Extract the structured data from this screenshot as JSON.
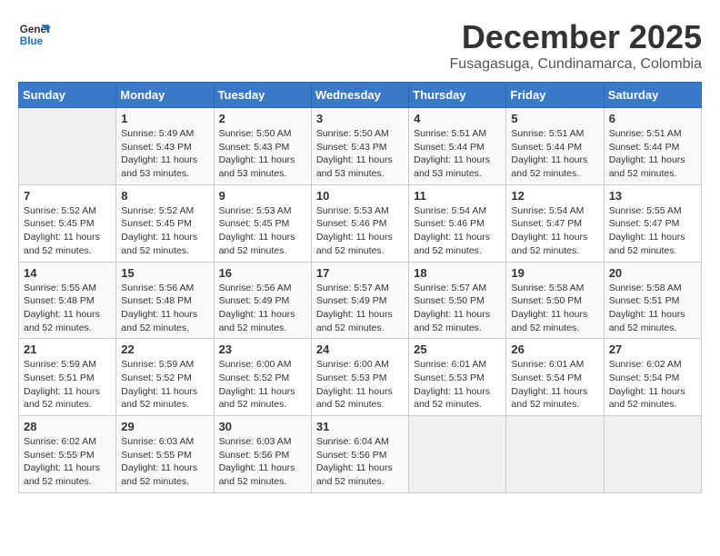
{
  "logo": {
    "line1": "General",
    "line2": "Blue"
  },
  "title": "December 2025",
  "location": "Fusagasuga, Cundinamarca, Colombia",
  "days_of_week": [
    "Sunday",
    "Monday",
    "Tuesday",
    "Wednesday",
    "Thursday",
    "Friday",
    "Saturday"
  ],
  "weeks": [
    [
      {
        "day": "",
        "info": ""
      },
      {
        "day": "1",
        "info": "Sunrise: 5:49 AM\nSunset: 5:43 PM\nDaylight: 11 hours\nand 53 minutes."
      },
      {
        "day": "2",
        "info": "Sunrise: 5:50 AM\nSunset: 5:43 PM\nDaylight: 11 hours\nand 53 minutes."
      },
      {
        "day": "3",
        "info": "Sunrise: 5:50 AM\nSunset: 5:43 PM\nDaylight: 11 hours\nand 53 minutes."
      },
      {
        "day": "4",
        "info": "Sunrise: 5:51 AM\nSunset: 5:44 PM\nDaylight: 11 hours\nand 53 minutes."
      },
      {
        "day": "5",
        "info": "Sunrise: 5:51 AM\nSunset: 5:44 PM\nDaylight: 11 hours\nand 52 minutes."
      },
      {
        "day": "6",
        "info": "Sunrise: 5:51 AM\nSunset: 5:44 PM\nDaylight: 11 hours\nand 52 minutes."
      }
    ],
    [
      {
        "day": "7",
        "info": "Sunrise: 5:52 AM\nSunset: 5:45 PM\nDaylight: 11 hours\nand 52 minutes."
      },
      {
        "day": "8",
        "info": "Sunrise: 5:52 AM\nSunset: 5:45 PM\nDaylight: 11 hours\nand 52 minutes."
      },
      {
        "day": "9",
        "info": "Sunrise: 5:53 AM\nSunset: 5:45 PM\nDaylight: 11 hours\nand 52 minutes."
      },
      {
        "day": "10",
        "info": "Sunrise: 5:53 AM\nSunset: 5:46 PM\nDaylight: 11 hours\nand 52 minutes."
      },
      {
        "day": "11",
        "info": "Sunrise: 5:54 AM\nSunset: 5:46 PM\nDaylight: 11 hours\nand 52 minutes."
      },
      {
        "day": "12",
        "info": "Sunrise: 5:54 AM\nSunset: 5:47 PM\nDaylight: 11 hours\nand 52 minutes."
      },
      {
        "day": "13",
        "info": "Sunrise: 5:55 AM\nSunset: 5:47 PM\nDaylight: 11 hours\nand 52 minutes."
      }
    ],
    [
      {
        "day": "14",
        "info": "Sunrise: 5:55 AM\nSunset: 5:48 PM\nDaylight: 11 hours\nand 52 minutes."
      },
      {
        "day": "15",
        "info": "Sunrise: 5:56 AM\nSunset: 5:48 PM\nDaylight: 11 hours\nand 52 minutes."
      },
      {
        "day": "16",
        "info": "Sunrise: 5:56 AM\nSunset: 5:49 PM\nDaylight: 11 hours\nand 52 minutes."
      },
      {
        "day": "17",
        "info": "Sunrise: 5:57 AM\nSunset: 5:49 PM\nDaylight: 11 hours\nand 52 minutes."
      },
      {
        "day": "18",
        "info": "Sunrise: 5:57 AM\nSunset: 5:50 PM\nDaylight: 11 hours\nand 52 minutes."
      },
      {
        "day": "19",
        "info": "Sunrise: 5:58 AM\nSunset: 5:50 PM\nDaylight: 11 hours\nand 52 minutes."
      },
      {
        "day": "20",
        "info": "Sunrise: 5:58 AM\nSunset: 5:51 PM\nDaylight: 11 hours\nand 52 minutes."
      }
    ],
    [
      {
        "day": "21",
        "info": "Sunrise: 5:59 AM\nSunset: 5:51 PM\nDaylight: 11 hours\nand 52 minutes."
      },
      {
        "day": "22",
        "info": "Sunrise: 5:59 AM\nSunset: 5:52 PM\nDaylight: 11 hours\nand 52 minutes."
      },
      {
        "day": "23",
        "info": "Sunrise: 6:00 AM\nSunset: 5:52 PM\nDaylight: 11 hours\nand 52 minutes."
      },
      {
        "day": "24",
        "info": "Sunrise: 6:00 AM\nSunset: 5:53 PM\nDaylight: 11 hours\nand 52 minutes."
      },
      {
        "day": "25",
        "info": "Sunrise: 6:01 AM\nSunset: 5:53 PM\nDaylight: 11 hours\nand 52 minutes."
      },
      {
        "day": "26",
        "info": "Sunrise: 6:01 AM\nSunset: 5:54 PM\nDaylight: 11 hours\nand 52 minutes."
      },
      {
        "day": "27",
        "info": "Sunrise: 6:02 AM\nSunset: 5:54 PM\nDaylight: 11 hours\nand 52 minutes."
      }
    ],
    [
      {
        "day": "28",
        "info": "Sunrise: 6:02 AM\nSunset: 5:55 PM\nDaylight: 11 hours\nand 52 minutes."
      },
      {
        "day": "29",
        "info": "Sunrise: 6:03 AM\nSunset: 5:55 PM\nDaylight: 11 hours\nand 52 minutes."
      },
      {
        "day": "30",
        "info": "Sunrise: 6:03 AM\nSunset: 5:56 PM\nDaylight: 11 hours\nand 52 minutes."
      },
      {
        "day": "31",
        "info": "Sunrise: 6:04 AM\nSunset: 5:56 PM\nDaylight: 11 hours\nand 52 minutes."
      },
      {
        "day": "",
        "info": ""
      },
      {
        "day": "",
        "info": ""
      },
      {
        "day": "",
        "info": ""
      }
    ]
  ]
}
